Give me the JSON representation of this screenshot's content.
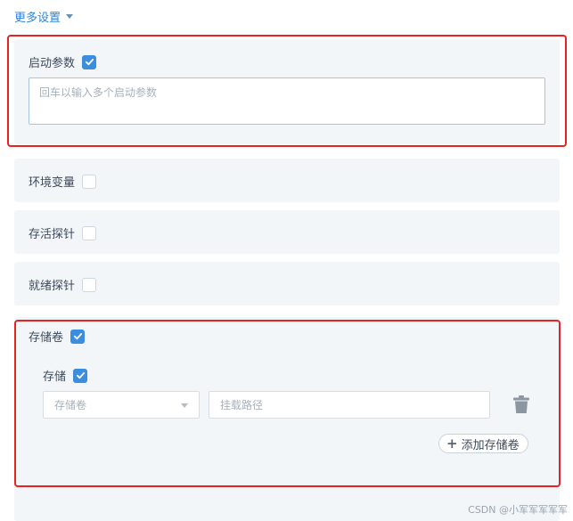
{
  "more_settings": {
    "label": "更多设置",
    "icon": "caret-down-icon"
  },
  "startup_params": {
    "label": "启动参数",
    "checked": true,
    "placeholder": "回车以输入多个启动参数"
  },
  "env_vars": {
    "label": "环境变量",
    "checked": false
  },
  "liveness_probe": {
    "label": "存活探针",
    "checked": false
  },
  "readiness_probe": {
    "label": "就绪探针",
    "checked": false
  },
  "storage_volumes": {
    "label": "存储卷",
    "checked": true,
    "storage": {
      "label": "存储",
      "checked": true,
      "volume_select_placeholder": "存储卷",
      "mount_path_placeholder": "挂载路径",
      "delete_icon": "trash-icon",
      "add_button_label": "添加存储卷"
    }
  },
  "watermark": "CSDN @小军军军军军",
  "colors": {
    "accent": "#3b8de0",
    "highlight": "#e42424",
    "panel_bg": "#f3f6f9"
  }
}
